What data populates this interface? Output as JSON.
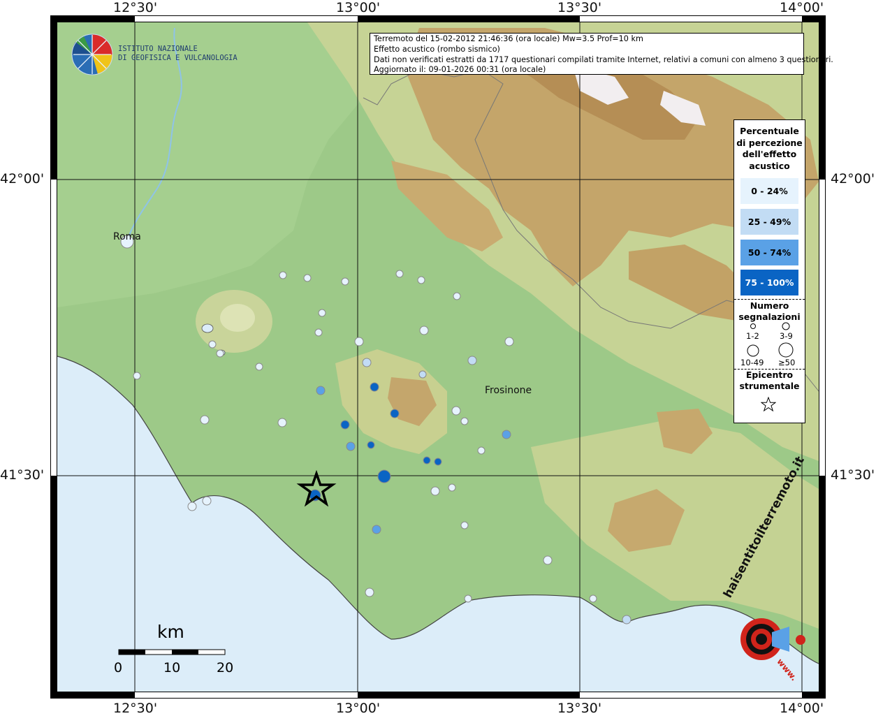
{
  "title_box": {
    "line1": "Terremoto del 15-02-2012 21:46:36 (ora locale) Mw=3.5 Prof=10 km",
    "line2": "Effetto acustico (rombo sismico)",
    "line3": "Dati non verificati estratti da 1717 questionari compilati tramite Internet, relativi a comuni con almeno 3 questionari.",
    "line4": "Aggiornato il: 09-01-2026 00:31 (ora locale)"
  },
  "institute": {
    "line1": "ISTITUTO NAZIONALE",
    "line2": "DI GEOFISICA E VULCANOLOGIA"
  },
  "coordinates": {
    "top": [
      "12°30'",
      "13°00'",
      "13°30'",
      "14°00'"
    ],
    "bottom": [
      "12°30'",
      "13°00'",
      "13°30'",
      "14°00'"
    ],
    "left": [
      "42°00'",
      "41°30'"
    ],
    "right": [
      "42°00'",
      "41°30'"
    ]
  },
  "cities": {
    "roma": "Roma",
    "frosinone": "Frosinone"
  },
  "legend": {
    "title_lines": [
      "Percentuale",
      "di percezione",
      "dell'effetto",
      "acustico"
    ],
    "classes": [
      {
        "label": "0 - 24%",
        "color": "#e6f3fd"
      },
      {
        "label": "25 - 49%",
        "color": "#c2dcf4"
      },
      {
        "label": "50 - 74%",
        "color": "#5aa1e6"
      },
      {
        "label": "75 - 100%",
        "color": "#0a64c4"
      }
    ],
    "count_title": [
      "Numero",
      "segnalazioni"
    ],
    "count_labels": [
      "1-2",
      "3-9",
      "10-49",
      "≥50"
    ],
    "epicenter_title": [
      "Epicentro",
      "strumentale"
    ]
  },
  "scale_bar": {
    "unit": "km",
    "ticks": [
      "0",
      "10",
      "20"
    ]
  },
  "watermark": {
    "text": "haisentitoilterremoto.it",
    "www": "www."
  },
  "colors": {
    "sea": "#dcedf9",
    "lowland": "#a2cc8c",
    "hills": "#c8d496",
    "mountains": "#c0a066",
    "peaks": "#f3eef0"
  }
}
